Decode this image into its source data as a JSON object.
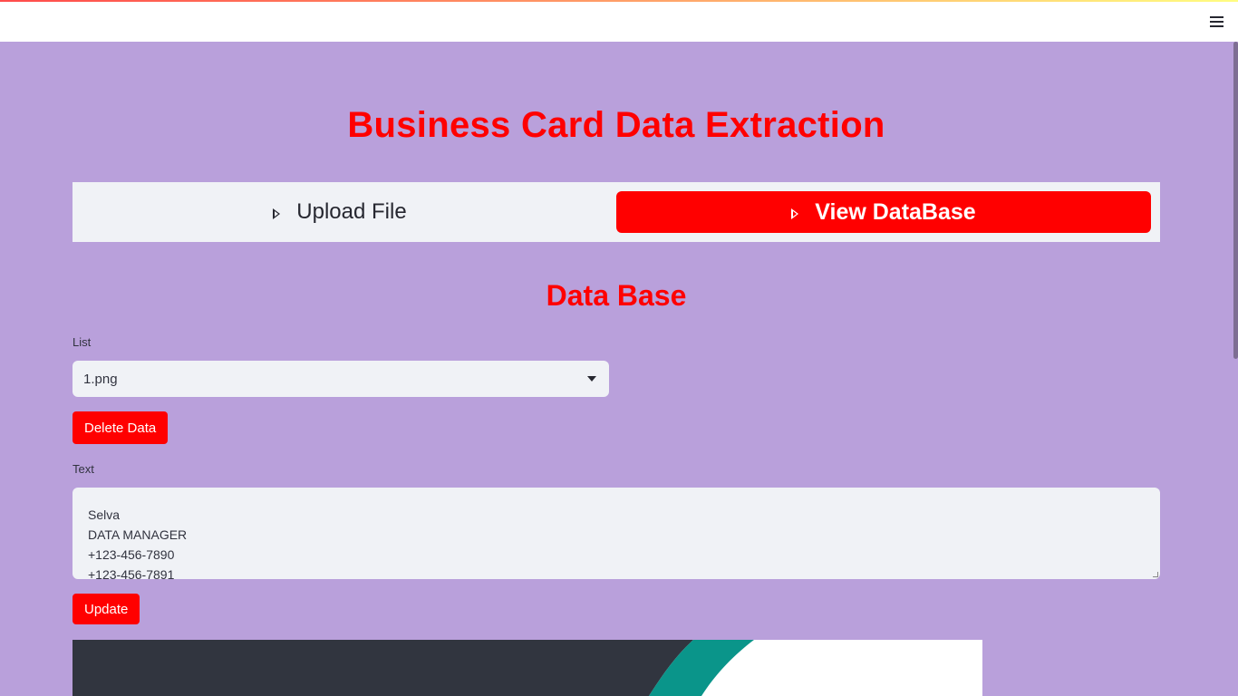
{
  "header": {
    "menu_icon": "hamburger-menu-icon"
  },
  "main": {
    "title": "Business Card Data Extraction",
    "tabs": [
      {
        "label": "Upload File",
        "active": false
      },
      {
        "label": "View DataBase",
        "active": true
      }
    ],
    "section_title": "Data Base",
    "list": {
      "label": "List",
      "selected": "1.png"
    },
    "delete_button": "Delete Data",
    "text": {
      "label": "Text",
      "lines": [
        "Selva",
        "DATA MANAGER",
        "+123-456-7890",
        "+123-456-7891"
      ]
    },
    "update_button": "Update"
  },
  "colors": {
    "background": "#b9a0db",
    "accent": "#ff0000",
    "panel": "#f0f2f6",
    "card_dark": "#31353f",
    "card_teal": "#0a958a"
  }
}
